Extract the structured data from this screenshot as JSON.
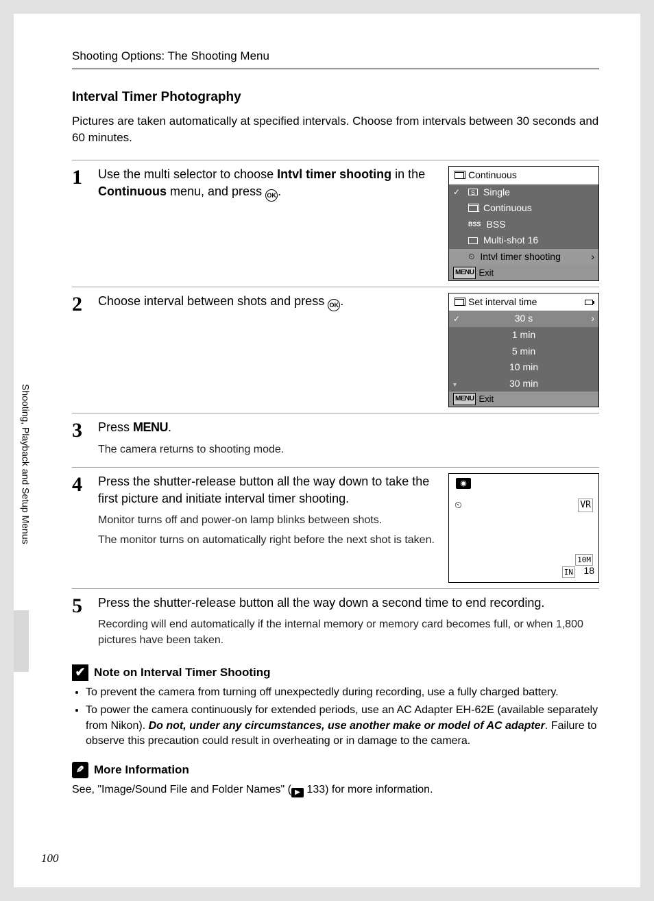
{
  "header": {
    "section": "Shooting Options: The Shooting Menu"
  },
  "title": "Interval Timer Photography",
  "intro": "Pictures are taken automatically at specified intervals. Choose from intervals between 30 seconds and 60 minutes.",
  "steps": {
    "s1": {
      "num": "1",
      "text_pre": "Use the multi selector to choose ",
      "bold1": "Intvl timer shooting",
      "text_mid": " in the ",
      "bold2": "Continuous",
      "text_post": " menu, and press "
    },
    "s2": {
      "num": "2",
      "text": "Choose interval between shots and press "
    },
    "s3": {
      "num": "3",
      "text_pre": "Press ",
      "menu": "MENU",
      "note": "The camera returns to shooting mode."
    },
    "s4": {
      "num": "4",
      "text": "Press the shutter-release button all the way down to take the first picture and initiate interval timer shooting.",
      "note1": "Monitor turns off and power-on lamp blinks between shots.",
      "note2": "The monitor turns on automatically right before the next shot is taken."
    },
    "s5": {
      "num": "5",
      "text": "Press the shutter-release button all the way down a second time to end recording.",
      "note": "Recording will end automatically if the internal memory or memory card becomes full, or when 1,800 pictures have been taken."
    }
  },
  "lcd1": {
    "title": "Continuous",
    "items": [
      "Single",
      "Continuous",
      "BSS",
      "Multi-shot 16",
      "Intvl timer shooting"
    ],
    "exit": "Exit"
  },
  "lcd2": {
    "title": "Set interval time",
    "items": [
      "30 s",
      "1 min",
      "5 min",
      "10 min",
      "30 min"
    ],
    "exit": "Exit"
  },
  "shoot": {
    "vr": "VR",
    "tenm": "10M",
    "in": "IN",
    "eighteen": "18"
  },
  "note_block": {
    "title": "Note on Interval Timer Shooting",
    "b1": "To prevent the camera from turning off unexpectedly during recording, use a fully charged battery.",
    "b2_pre": "To power the camera continuously for extended periods, use an AC Adapter EH-62E (available separately from Nikon). ",
    "b2_bold": "Do not, under any circumstances, use another make or model of AC adapter",
    "b2_post": ". Failure to observe this precaution could result in overheating or in damage to the camera."
  },
  "more_info": {
    "title": "More Information",
    "text_pre": "See, \"Image/Sound File and Folder Names\" (",
    "ref": "133",
    "text_post": ") for more information."
  },
  "sidebar": "Shooting, Playback and Setup Menus",
  "page_num": "100"
}
